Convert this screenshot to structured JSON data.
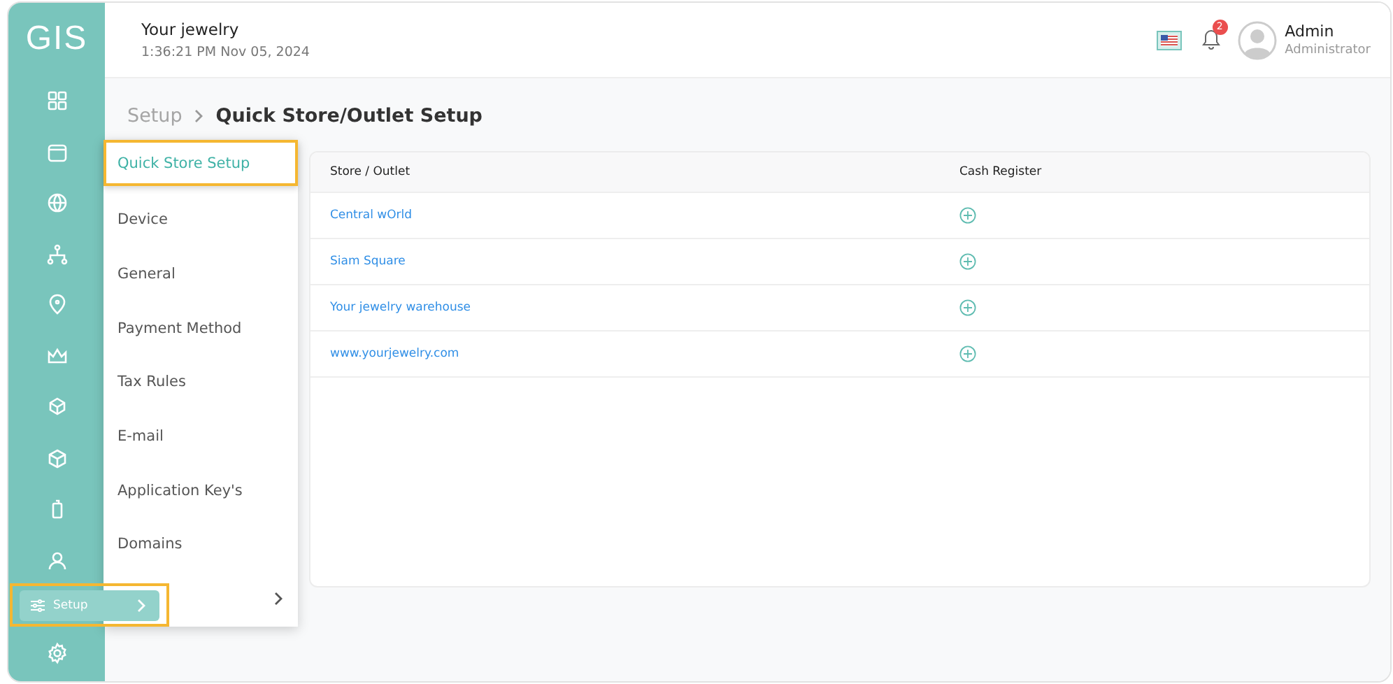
{
  "logo": "GIS",
  "header": {
    "store": "Your jewelry",
    "datetime": "1:36:21 PM Nov 05, 2024",
    "notifications": "2",
    "user": {
      "name": "Admin",
      "role": "Administrator"
    }
  },
  "breadcrumb": {
    "parent": "Setup",
    "current": "Quick Store/Outlet Setup"
  },
  "sidebar_active": {
    "label": "Setup",
    "highlighted": true
  },
  "submenu": [
    {
      "kind": "link",
      "label": "Quick Store Setup",
      "selected": true,
      "highlighted": true,
      "has_children": false
    },
    {
      "kind": "link",
      "label": "Device",
      "selected": false,
      "highlighted": false,
      "has_children": false
    },
    {
      "kind": "link",
      "label": "General",
      "selected": false,
      "highlighted": false,
      "has_children": false
    },
    {
      "kind": "link",
      "label": "Payment Method",
      "selected": false,
      "highlighted": false,
      "has_children": false
    },
    {
      "kind": "link",
      "label": "Tax Rules",
      "selected": false,
      "highlighted": false,
      "has_children": false
    },
    {
      "kind": "link",
      "label": "E-mail",
      "selected": false,
      "highlighted": false,
      "has_children": false
    },
    {
      "kind": "link",
      "label": "Application Key's",
      "selected": false,
      "highlighted": false,
      "has_children": false
    },
    {
      "kind": "link",
      "label": "Domains",
      "selected": false,
      "highlighted": false,
      "has_children": false
    },
    {
      "kind": "more",
      "selected": false,
      "highlighted": false,
      "has_children": true
    }
  ],
  "table": {
    "columns": [
      "Store / Outlet",
      "Cash Register"
    ],
    "rows": [
      {
        "store": "Central wOrld"
      },
      {
        "store": "Siam Square"
      },
      {
        "store": "Your jewelry warehouse"
      },
      {
        "store": "www.yourjewelry.com"
      }
    ]
  }
}
